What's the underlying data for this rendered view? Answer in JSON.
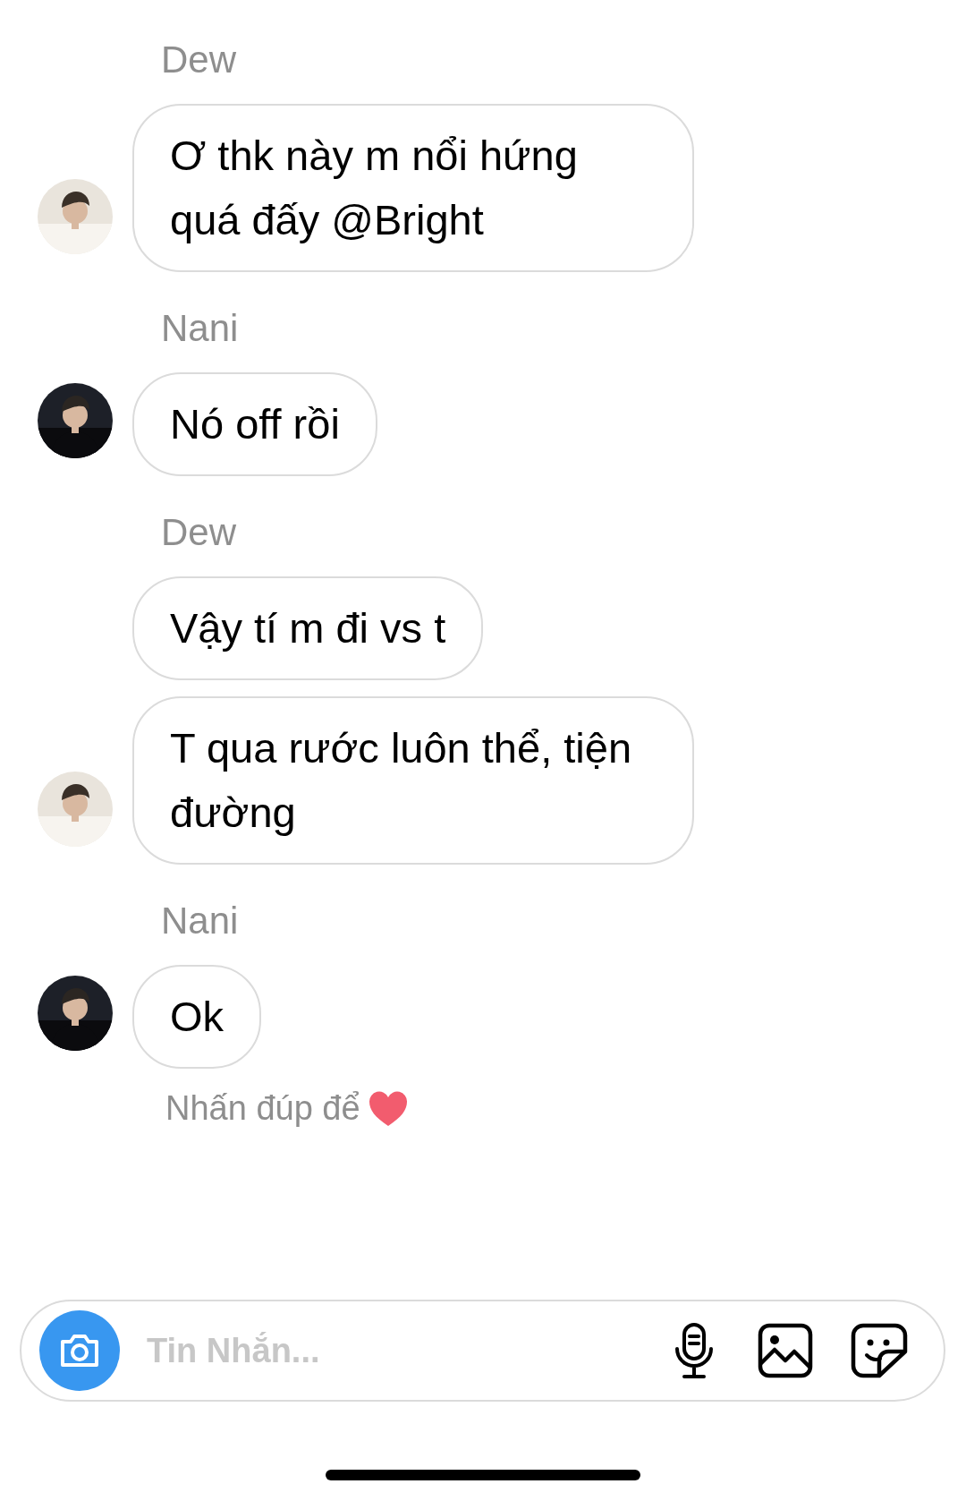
{
  "conversation": [
    {
      "sender": "Dew",
      "kind": "light",
      "messages": [
        "Ơ thk này m nổi hứng quá đấy @Bright"
      ]
    },
    {
      "sender": "Nani",
      "kind": "dark",
      "messages": [
        "Nó off rồi"
      ]
    },
    {
      "sender": "Dew",
      "kind": "light",
      "messages": [
        "Vậy tí m đi vs t",
        "T qua rước luôn thể, tiện đường"
      ]
    },
    {
      "sender": "Nani",
      "kind": "dark",
      "messages": [
        "Ok"
      ]
    }
  ],
  "hint": "Nhấn đúp để",
  "composer": {
    "placeholder": "Tin Nhắn..."
  }
}
